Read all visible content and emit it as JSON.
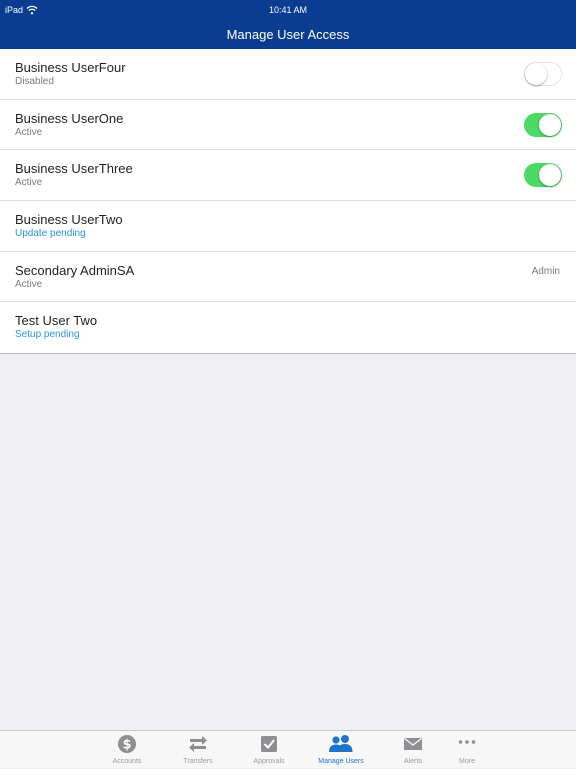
{
  "status_bar": {
    "device": "iPad",
    "time": "10:41 AM"
  },
  "nav": {
    "title": "Manage User Access"
  },
  "users": [
    {
      "name": "Business UserFour",
      "status": "Disabled",
      "status_kind": "normal",
      "control": "toggle",
      "enabled": false
    },
    {
      "name": "Business UserOne",
      "status": "Active",
      "status_kind": "normal",
      "control": "toggle",
      "enabled": true
    },
    {
      "name": "Business UserThree",
      "status": "Active",
      "status_kind": "normal",
      "control": "toggle",
      "enabled": true
    },
    {
      "name": "Business UserTwo",
      "status": "Update pending",
      "status_kind": "pending",
      "control": "none"
    },
    {
      "name": "Secondary AdminSA",
      "status": "Active",
      "status_kind": "normal",
      "control": "role",
      "role": "Admin"
    },
    {
      "name": "Test User Two",
      "status": "Setup pending",
      "status_kind": "pending",
      "control": "none"
    }
  ],
  "tabs": [
    {
      "label": "Accounts",
      "icon": "dollar-icon",
      "active": false
    },
    {
      "label": "Transfers",
      "icon": "transfer-arrows-icon",
      "active": false
    },
    {
      "label": "Approvals",
      "icon": "checkbox-icon",
      "active": false
    },
    {
      "label": "Manage Users",
      "icon": "users-icon",
      "active": true
    },
    {
      "label": "Alerts",
      "icon": "envelope-icon",
      "active": false
    },
    {
      "label": "More",
      "icon": "ellipsis-icon",
      "active": false
    }
  ],
  "colors": {
    "nav_background": "#0a3d91",
    "toggle_on": "#4cd964",
    "pending_text": "#2a93d5",
    "tab_active": "#1f73c9",
    "tab_inactive": "#8e8e93"
  }
}
